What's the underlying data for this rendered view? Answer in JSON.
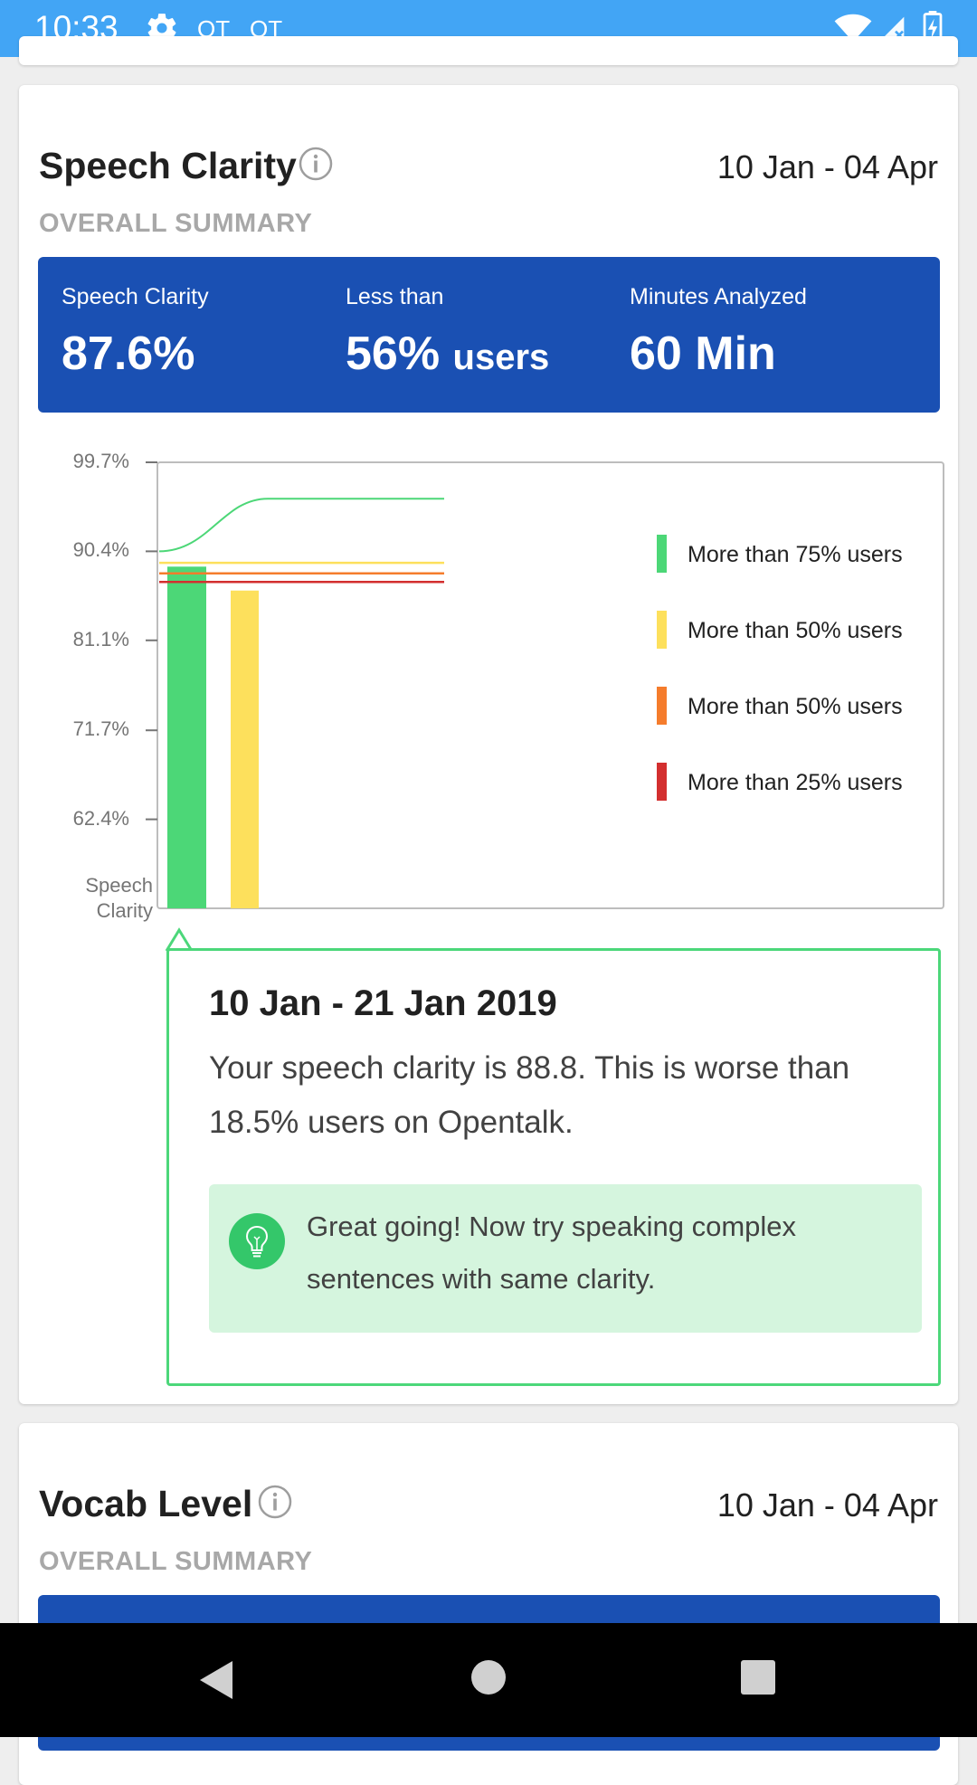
{
  "status_bar": {
    "time": "10:33",
    "indicators": [
      "OT",
      "OT"
    ]
  },
  "speech_card": {
    "title": "Speech Clarity",
    "date_range": "10 Jan - 04 Apr",
    "overall_label": "OVERALL SUMMARY",
    "summary": {
      "metric_label": "Speech Clarity",
      "metric_value": "87.6%",
      "compare_label": "Less than",
      "compare_value": "56%",
      "compare_unit": "users",
      "minutes_label": "Minutes Analyzed",
      "minutes_value": "60 Min"
    },
    "popup": {
      "title": "10 Jan - 21 Jan 2019",
      "text": "Your speech clarity is 88.8. This is worse than 18.5% users on Opentalk.",
      "tip": "Great going! Now try speaking complex sentences with same clarity."
    }
  },
  "vocab_card": {
    "title": "Vocab Level",
    "date_range": "10 Jan - 04 Apr",
    "overall_label": "OVERALL SUMMARY"
  },
  "colors": {
    "status_bar": "#42a5f5",
    "summary_bg": "#1a50b3",
    "green": "#4cd777",
    "yellow": "#fde05c",
    "orange": "#f57c2c",
    "red": "#d32f2f",
    "tip_bg": "#d5f5de"
  },
  "chart_data": {
    "type": "bar",
    "ylabel": "Speech Clarity",
    "yticks": [
      "99.7%",
      "90.4%",
      "81.1%",
      "71.7%",
      "62.4%"
    ],
    "ylim": [
      53.1,
      99.7
    ],
    "bars": [
      {
        "color": "#4cd777",
        "value": 88.8
      },
      {
        "color": "#fde05c",
        "value": 86.3
      }
    ],
    "reference_lines": [
      {
        "label": "More than 75% users",
        "color": "#4cd777",
        "start": 90.4,
        "end": 95.9
      },
      {
        "label": "More than 50% users",
        "color": "#fde05c",
        "end": 89.2
      },
      {
        "label": "More than 50% users",
        "color": "#f57c2c",
        "end": 88.1
      },
      {
        "label": "More than 25% users",
        "color": "#d32f2f",
        "end": 87.2
      }
    ],
    "legend": [
      {
        "label": "More than 75% users",
        "color": "#4cd777"
      },
      {
        "label": "More than 50% users",
        "color": "#fde05c"
      },
      {
        "label": "More than 50% users",
        "color": "#f57c2c"
      },
      {
        "label": "More than 25% users",
        "color": "#d32f2f"
      }
    ],
    "legend_position": "right"
  }
}
